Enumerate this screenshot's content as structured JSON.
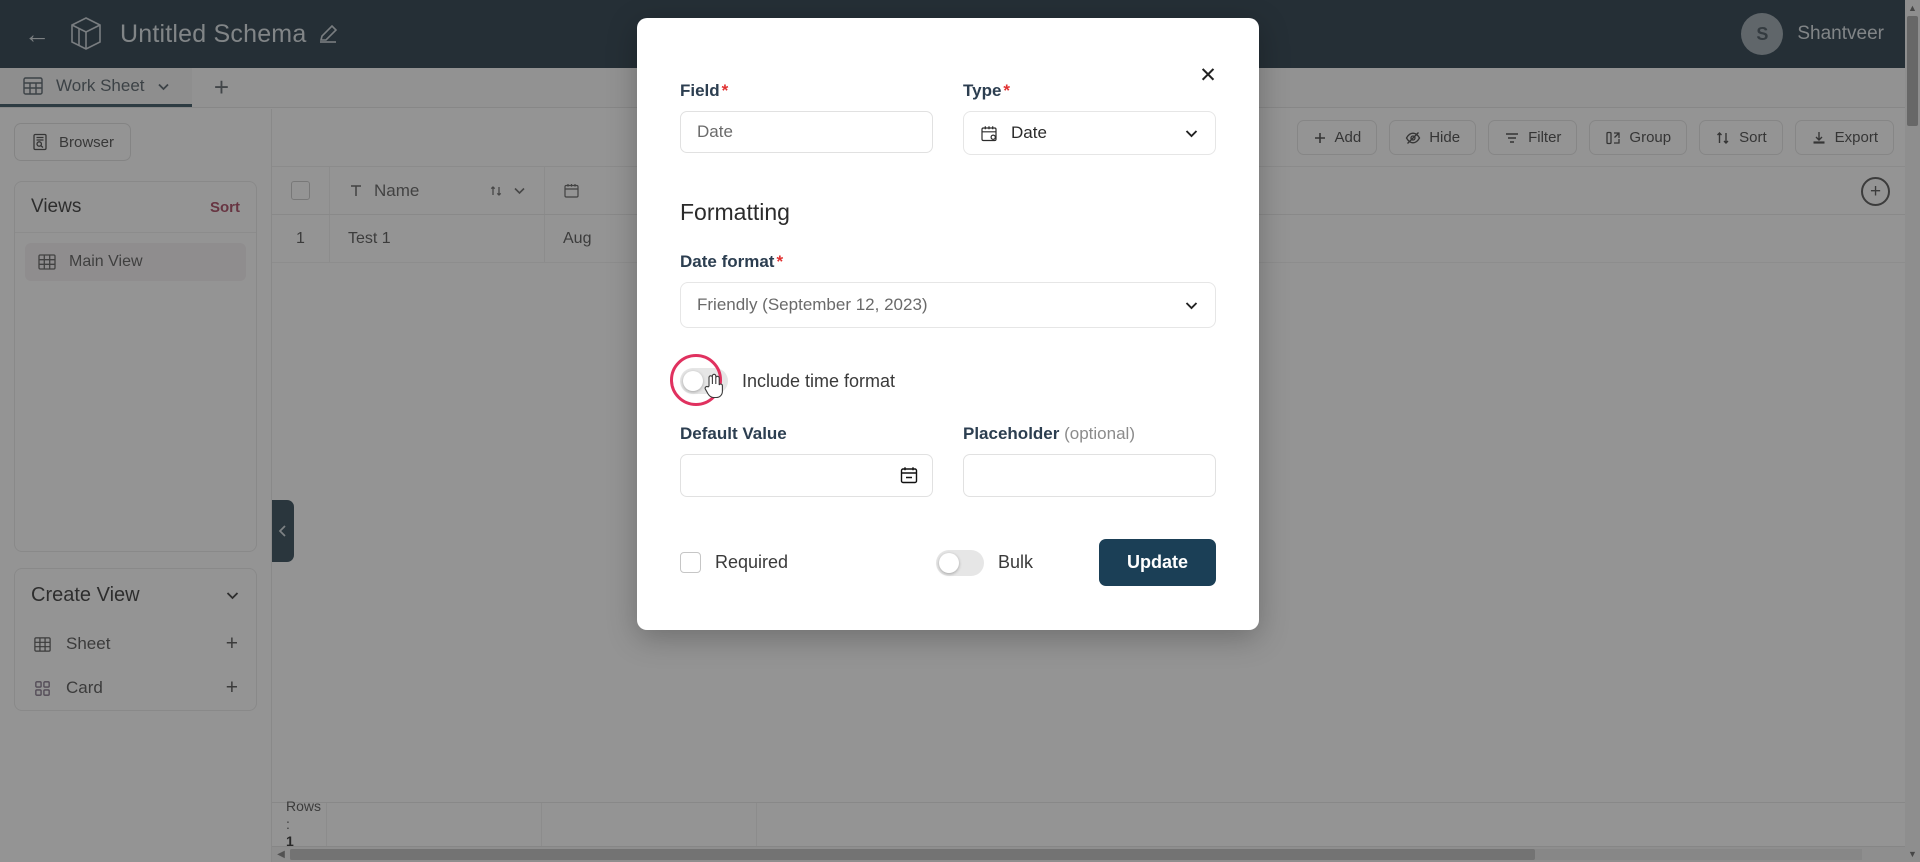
{
  "topbar": {
    "back_icon": "arrow-left-icon",
    "logo_icon": "cube-logo-icon",
    "schema_title": "Untitled Schema",
    "edit_icon": "pencil-icon",
    "avatar_initial": "S",
    "username": "Shantveer"
  },
  "tabs": {
    "sheet_icon": "table-icon",
    "sheet_label": "Work Sheet",
    "chevron_icon": "chevron-down-icon",
    "add_tab_label": "+"
  },
  "sidebar": {
    "browser_label": "Browser",
    "browser_icon": "browser-icon",
    "views_title": "Views",
    "views_sort_label": "Sort",
    "views": [
      {
        "label": "Main View",
        "icon": "grid-icon"
      }
    ],
    "create_view_title": "Create View",
    "create_view_chevron": "chevron-down-icon",
    "create_options": [
      {
        "label": "Sheet",
        "icon": "grid-icon",
        "action": "+"
      },
      {
        "label": "Card",
        "icon": "cards-icon",
        "action": "+"
      }
    ]
  },
  "toolbar": {
    "buttons": [
      {
        "label": "Add",
        "icon": "plus-icon"
      },
      {
        "label": "Hide",
        "icon": "eye-off-icon"
      },
      {
        "label": "Filter",
        "icon": "filter-icon"
      },
      {
        "label": "Group",
        "icon": "group-icon"
      },
      {
        "label": "Sort",
        "icon": "sort-icon"
      },
      {
        "label": "Export",
        "icon": "download-icon"
      }
    ]
  },
  "grid": {
    "columns": [
      {
        "label": "Name",
        "type_icon": "text-icon"
      },
      {
        "label": "",
        "type_icon": "calendar-icon"
      }
    ],
    "sort_icon": "sort-arrows-icon",
    "menu_icon": "chevron-down-icon",
    "add_column_icon": "plus-circle-icon",
    "rows": [
      {
        "num": "1",
        "name": "Test 1",
        "date": "Aug"
      }
    ],
    "footer_rows_label": "Rows :",
    "footer_rows_value": "1"
  },
  "collapse_handle": {
    "icon": "chevron-left-icon"
  },
  "modal": {
    "close_icon": "close-icon",
    "field_label": "Field",
    "field_required_mark": "*",
    "field_value": "Date",
    "field_placeholder": "Date",
    "type_label": "Type",
    "type_required_mark": "*",
    "type_value": "Date",
    "type_icon": "calendar-icon",
    "type_caret": "chevron-down-icon",
    "formatting_title": "Formatting",
    "date_format_label": "Date format",
    "date_format_required_mark": "*",
    "date_format_value": "Friendly (September 12, 2023)",
    "date_format_caret": "chevron-down-icon",
    "include_time_label": "Include time format",
    "include_time_on": false,
    "annotation_color": "#e0315f",
    "default_value_label": "Default Value",
    "default_value_text": "",
    "default_value_icon": "calendar-icon",
    "placeholder_label": "Placeholder",
    "placeholder_optional": "(optional)",
    "placeholder_value": "",
    "required_label": "Required",
    "required_checked": false,
    "bulk_label": "Bulk",
    "bulk_on": false,
    "update_label": "Update",
    "update_color": "#1b3f56"
  }
}
